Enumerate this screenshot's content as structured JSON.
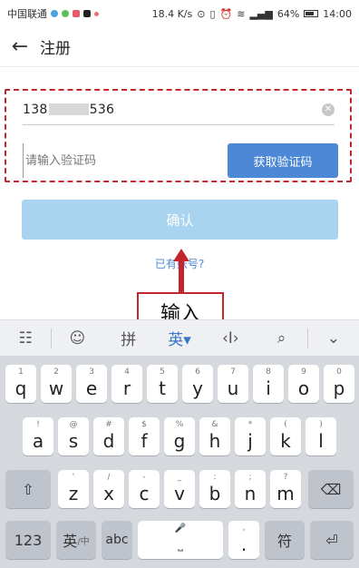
{
  "status_bar": {
    "carrier": "中国联通",
    "speed": "18.4 K/s",
    "battery": "64%",
    "time": "14:00"
  },
  "header": {
    "title": "注册"
  },
  "form": {
    "phone_prefix": "138",
    "phone_suffix": "536",
    "code_placeholder": "请输入验证码",
    "get_code_label": "获取验证码",
    "confirm_label": "确认",
    "have_account": "已有账号?"
  },
  "annotation": {
    "label": "输入"
  },
  "ime": {
    "items": [
      "☷",
      "☺",
      "拼",
      "英▾",
      "‹I›",
      "⌕",
      "⌄"
    ]
  },
  "keyboard": {
    "row1": [
      {
        "k": "q",
        "h": "1"
      },
      {
        "k": "w",
        "h": "2"
      },
      {
        "k": "e",
        "h": "3"
      },
      {
        "k": "r",
        "h": "4"
      },
      {
        "k": "t",
        "h": "5"
      },
      {
        "k": "y",
        "h": "6"
      },
      {
        "k": "u",
        "h": "7"
      },
      {
        "k": "i",
        "h": "8"
      },
      {
        "k": "o",
        "h": "9"
      },
      {
        "k": "p",
        "h": "0"
      }
    ],
    "row2": [
      {
        "k": "a",
        "h": "!"
      },
      {
        "k": "s",
        "h": "@"
      },
      {
        "k": "d",
        "h": "#"
      },
      {
        "k": "f",
        "h": "$"
      },
      {
        "k": "g",
        "h": "%"
      },
      {
        "k": "h",
        "h": "&"
      },
      {
        "k": "j",
        "h": "*"
      },
      {
        "k": "k",
        "h": "("
      },
      {
        "k": "l",
        "h": ")"
      }
    ],
    "row3": [
      {
        "k": "z",
        "h": "'"
      },
      {
        "k": "x",
        "h": "/"
      },
      {
        "k": "c",
        "h": "-"
      },
      {
        "k": "v",
        "h": "_"
      },
      {
        "k": "b",
        "h": ":"
      },
      {
        "k": "n",
        "h": ";"
      },
      {
        "k": "m",
        "h": "?"
      }
    ],
    "shift": "⇧",
    "backspace": "⌫",
    "num_label": "123",
    "lang_label": "英",
    "lang_sub": "/中",
    "abc_label": "abc",
    "space_label": "⎵",
    "mic": "🎤",
    "punct_top": ",",
    "punct_bottom": ".",
    "symbol_label": "符",
    "enter": "⏎"
  }
}
